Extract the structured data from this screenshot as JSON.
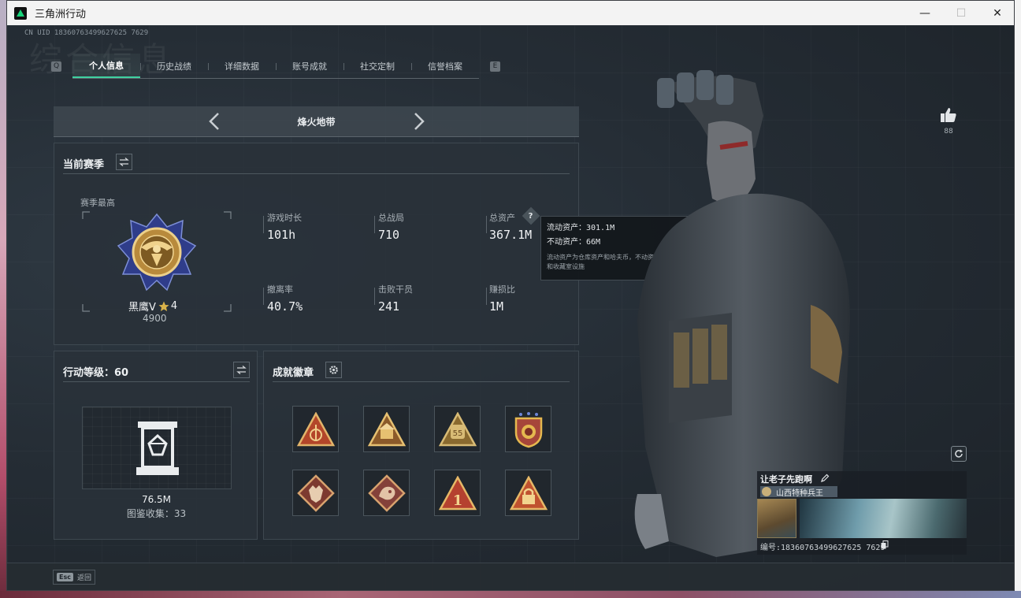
{
  "window": {
    "title": "三角洲行动",
    "minimize": "—",
    "maximize": "☐",
    "close": "✕"
  },
  "uid_top": "CN UID 18360763499627625 7629",
  "watermark": "综合信息",
  "nav": {
    "left_key": "Q",
    "right_key": "E",
    "tabs": [
      {
        "label": "个人信息",
        "active": true
      },
      {
        "label": "历史战绩"
      },
      {
        "label": "详细数据"
      },
      {
        "label": "账号成就"
      },
      {
        "label": "社交定制"
      },
      {
        "label": "信誉档案"
      }
    ]
  },
  "mode": {
    "title": "烽火地带"
  },
  "season": {
    "title": "当前赛季",
    "best_label": "赛季最高",
    "rank_name": "黑鹰V",
    "rank_stars": "4",
    "rank_points": "4900",
    "stats": [
      {
        "label": "游戏时长",
        "value": "101h"
      },
      {
        "label": "总战局",
        "value": "710"
      },
      {
        "label": "总资产",
        "value": "367.1M"
      },
      {
        "label": "撤离率",
        "value": "40.7%"
      },
      {
        "label": "击败干员",
        "value": "241"
      },
      {
        "label": "赚损比",
        "value": "1M"
      }
    ],
    "help_icon": "?"
  },
  "tooltip": {
    "liquid": "流动资产：301.1M",
    "fixed": "不动资产：66M",
    "note": "流动资产为仓库资产和哈夫币，不动资产为特勤处设施和收藏室设施"
  },
  "level": {
    "title": "行动等级：60",
    "collection_value": "76.5M",
    "collection_label": "图鉴收集：33"
  },
  "achievements": {
    "title": "成就徽章",
    "badges": [
      {
        "icon": "triangle-hammer-badge",
        "color": "#b3462a"
      },
      {
        "icon": "triangle-tower-badge",
        "color": "#c9a24b"
      },
      {
        "icon": "triangle-55-badge",
        "color": "#b89a55"
      },
      {
        "icon": "shield-stars-badge",
        "color": "#d8a93a"
      },
      {
        "icon": "diamond-wolf-badge",
        "color": "#9a4b3e"
      },
      {
        "icon": "diamond-dragon-badge",
        "color": "#9a5045"
      },
      {
        "icon": "triangle-one-badge",
        "color": "#b5412f"
      },
      {
        "icon": "triangle-lock-badge",
        "color": "#c0522f"
      }
    ]
  },
  "like": {
    "count": "88"
  },
  "player": {
    "name": "让老子先跑啊",
    "title": "山西特种兵王",
    "id": "编号:18360763499627625 7629"
  },
  "bottom": {
    "esc_key": "Esc",
    "esc_label": "返回"
  }
}
